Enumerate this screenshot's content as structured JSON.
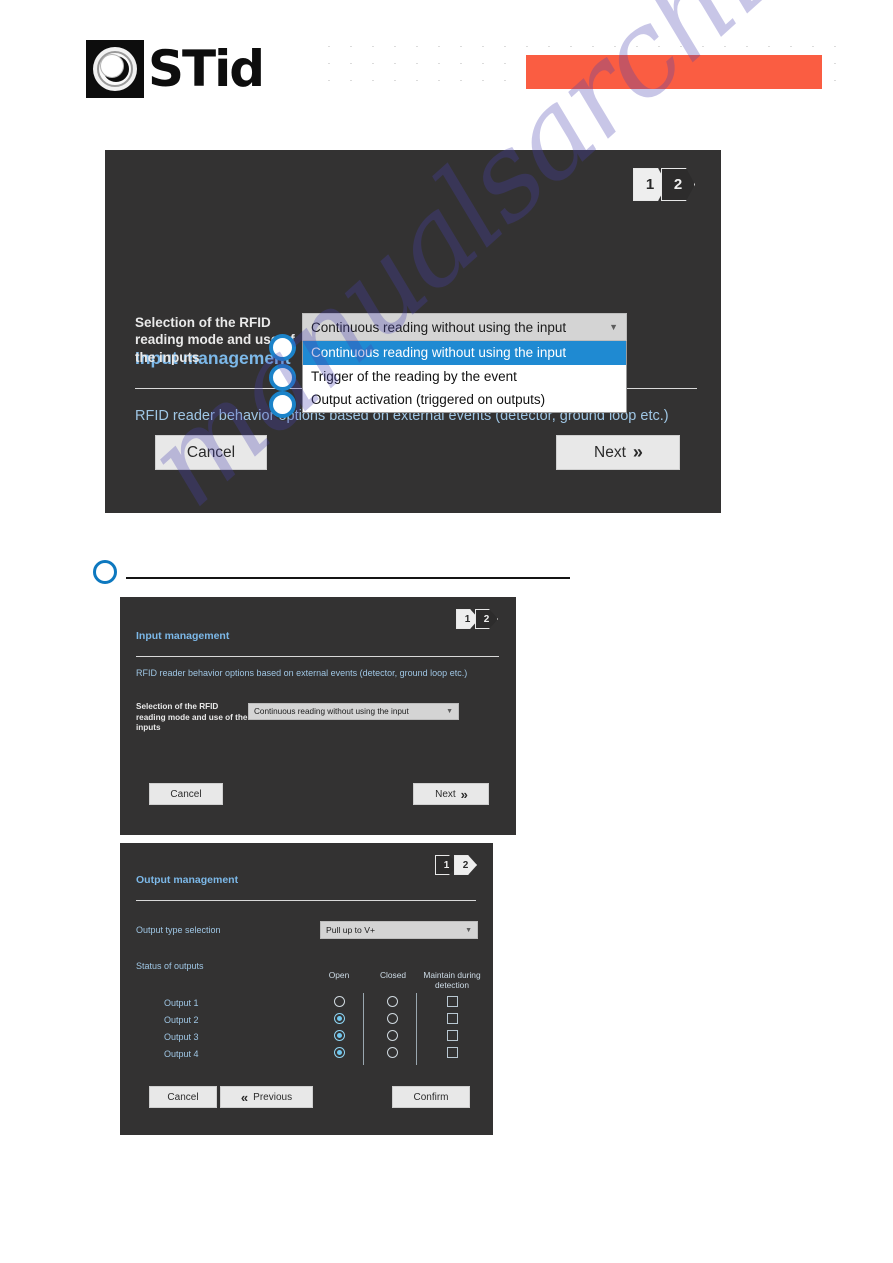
{
  "header": {
    "brand": "STid",
    "logo_icon": "stid-concentric-circles-logo",
    "accent_color": "#fa5d42"
  },
  "watermark": {
    "text": "manualsarchive.com"
  },
  "panel_one": {
    "title": "Input management",
    "subtitle": "RFID reader behavior options based on external events (detector, ground loop etc.)",
    "steps": [
      {
        "label": "1",
        "state": "active"
      },
      {
        "label": "2",
        "state": "inactive"
      }
    ],
    "field": {
      "label": "Selection of the RFID reading mode and use of the inputs",
      "value": "Continuous reading without using the input",
      "arrow_icon": "chevron-down-icon",
      "options": [
        "Continuous reading without using the input",
        "Trigger of the reading by the event",
        "Output activation (triggered on outputs)"
      ],
      "selected_index": 0
    },
    "buttons": {
      "cancel": "Cancel",
      "next": "Next",
      "next_icon": "double-chevron-right-icon"
    }
  },
  "callout": {
    "marker_icon": "blue-ring-marker-icon"
  },
  "panel_two": {
    "title": "Input management",
    "subtitle": "RFID reader behavior options based on external events (detector, ground loop etc.)",
    "steps": [
      {
        "label": "1",
        "state": "active"
      },
      {
        "label": "2",
        "state": "inactive"
      }
    ],
    "field": {
      "label": "Selection of the RFID reading mode and use of the inputs",
      "value": "Continuous reading without using the input",
      "arrow_icon": "chevron-down-icon"
    },
    "buttons": {
      "cancel": "Cancel",
      "next": "Next",
      "next_icon": "double-chevron-right-icon"
    }
  },
  "panel_three": {
    "title": "Output management",
    "steps": [
      {
        "label": "1",
        "state": "inactive"
      },
      {
        "label": "2",
        "state": "active"
      }
    ],
    "type_selection": {
      "label": "Output type selection",
      "value": "Pull up to V+",
      "arrow_icon": "chevron-down-icon"
    },
    "status_label": "Status of outputs",
    "columns": [
      "Open",
      "Closed",
      "Maintain during detection"
    ],
    "rows": [
      {
        "label": "Output 1",
        "open": false,
        "closed": false,
        "maintain": false
      },
      {
        "label": "Output 2",
        "open": true,
        "closed": false,
        "maintain": false
      },
      {
        "label": "Output 3",
        "open": true,
        "closed": false,
        "maintain": false
      },
      {
        "label": "Output 4",
        "open": true,
        "closed": false,
        "maintain": false
      }
    ],
    "buttons": {
      "cancel": "Cancel",
      "previous": "Previous",
      "previous_icon": "double-chevron-left-icon",
      "confirm": "Confirm"
    }
  }
}
